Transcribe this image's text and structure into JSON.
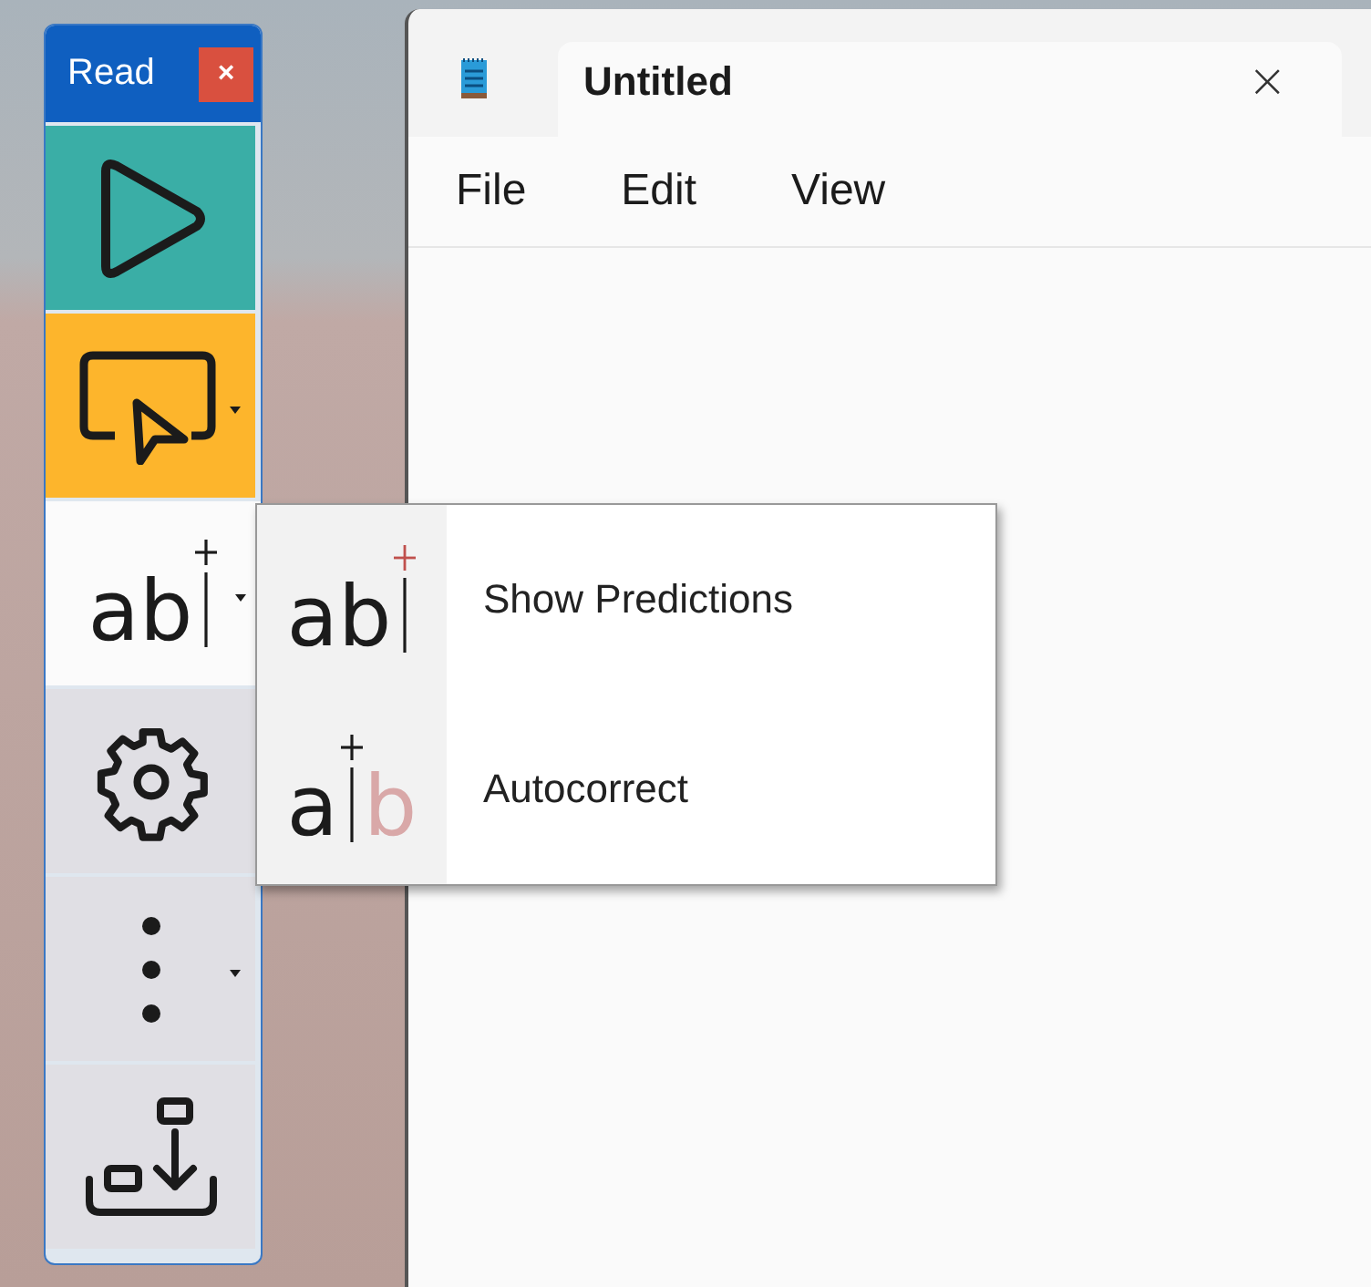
{
  "reading_toolbar": {
    "title": "Read",
    "close": "×",
    "buttons": [
      {
        "kind": "play",
        "dropdown": false,
        "selected": false
      },
      {
        "kind": "select",
        "dropdown": true,
        "selected": false
      },
      {
        "kind": "predictions",
        "glyph": "ab",
        "dropdown": true,
        "selected": true
      },
      {
        "kind": "settings",
        "dropdown": false,
        "selected": false
      },
      {
        "kind": "more",
        "dropdown": true,
        "selected": false
      },
      {
        "kind": "save",
        "dropdown": false,
        "selected": false
      }
    ]
  },
  "popup_menu": {
    "items": [
      {
        "kind": "predictions",
        "glyph": "ab",
        "label": "Show Predictions"
      },
      {
        "kind": "autocorrect",
        "glyph": "a",
        "glyph_after": "b",
        "label": "Autocorrect"
      }
    ]
  },
  "notepad": {
    "tab": {
      "title": "Untitled",
      "close": "×"
    },
    "menu": [
      "File",
      "Edit",
      "View"
    ]
  }
}
